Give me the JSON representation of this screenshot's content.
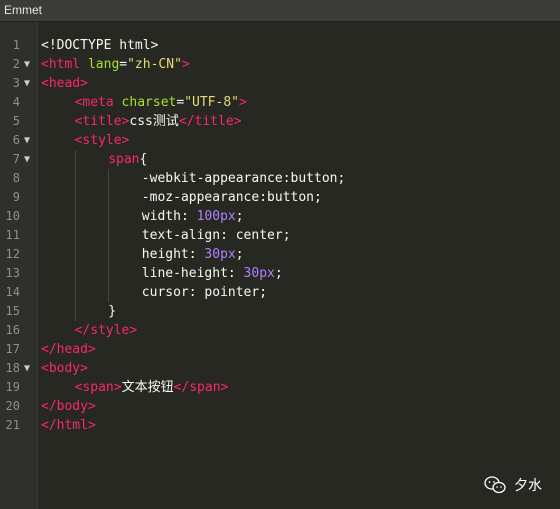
{
  "window": {
    "title": "Emmet"
  },
  "code": {
    "lines": [
      {
        "n": "1",
        "fold": "",
        "indent": 0,
        "tokens": [
          {
            "t": "<!DOCTYPE html>",
            "c": "txt"
          }
        ]
      },
      {
        "n": "2",
        "fold": "▼",
        "indent": 0,
        "tokens": [
          {
            "t": "<",
            "c": "tag"
          },
          {
            "t": "html",
            "c": "tag"
          },
          {
            "t": " lang",
            "c": "attr"
          },
          {
            "t": "=",
            "c": "txt"
          },
          {
            "t": "\"zh-CN\"",
            "c": "str"
          },
          {
            "t": ">",
            "c": "tag"
          }
        ]
      },
      {
        "n": "3",
        "fold": "▼",
        "indent": 0,
        "tokens": [
          {
            "t": "<head>",
            "c": "tag"
          }
        ]
      },
      {
        "n": "4",
        "fold": "",
        "indent": 1,
        "tokens": [
          {
            "t": "<meta",
            "c": "tag"
          },
          {
            "t": " charset",
            "c": "attr"
          },
          {
            "t": "=",
            "c": "txt"
          },
          {
            "t": "\"UTF-8\"",
            "c": "str"
          },
          {
            "t": ">",
            "c": "tag"
          }
        ]
      },
      {
        "n": "5",
        "fold": "",
        "indent": 1,
        "tokens": [
          {
            "t": "<title>",
            "c": "tag"
          },
          {
            "t": "css测试",
            "c": "txt"
          },
          {
            "t": "</title>",
            "c": "tag"
          }
        ]
      },
      {
        "n": "6",
        "fold": "▼",
        "indent": 1,
        "tokens": [
          {
            "t": "<style>",
            "c": "tag"
          }
        ]
      },
      {
        "n": "7",
        "fold": "▼",
        "indent": 2,
        "tokens": [
          {
            "t": "span",
            "c": "sel"
          },
          {
            "t": "{",
            "c": "txt"
          }
        ]
      },
      {
        "n": "8",
        "fold": "",
        "indent": 3,
        "tokens": [
          {
            "t": "-webkit-",
            "c": "txt"
          },
          {
            "t": "appearance",
            "c": "prop"
          },
          {
            "t": ":button;",
            "c": "txt"
          }
        ]
      },
      {
        "n": "9",
        "fold": "",
        "indent": 3,
        "tokens": [
          {
            "t": "-moz-",
            "c": "txt"
          },
          {
            "t": "appearance",
            "c": "prop"
          },
          {
            "t": ":button;",
            "c": "txt"
          }
        ]
      },
      {
        "n": "10",
        "fold": "",
        "indent": 3,
        "tokens": [
          {
            "t": "width",
            "c": "prop"
          },
          {
            "t": ": ",
            "c": "txt"
          },
          {
            "t": "100px",
            "c": "num"
          },
          {
            "t": ";",
            "c": "txt"
          }
        ]
      },
      {
        "n": "11",
        "fold": "",
        "indent": 3,
        "tokens": [
          {
            "t": "text-align",
            "c": "prop"
          },
          {
            "t": ": center;",
            "c": "txt"
          }
        ]
      },
      {
        "n": "12",
        "fold": "",
        "indent": 3,
        "tokens": [
          {
            "t": "height",
            "c": "prop"
          },
          {
            "t": ": ",
            "c": "txt"
          },
          {
            "t": "30px",
            "c": "num"
          },
          {
            "t": ";",
            "c": "txt"
          }
        ]
      },
      {
        "n": "13",
        "fold": "",
        "indent": 3,
        "tokens": [
          {
            "t": "line-height",
            "c": "prop"
          },
          {
            "t": ": ",
            "c": "txt"
          },
          {
            "t": "30px",
            "c": "num"
          },
          {
            "t": ";",
            "c": "txt"
          }
        ]
      },
      {
        "n": "14",
        "fold": "",
        "indent": 3,
        "tokens": [
          {
            "t": "cursor",
            "c": "prop"
          },
          {
            "t": ": pointer;",
            "c": "txt"
          }
        ]
      },
      {
        "n": "15",
        "fold": "",
        "indent": 2,
        "tokens": [
          {
            "t": "}",
            "c": "txt"
          }
        ]
      },
      {
        "n": "16",
        "fold": "",
        "indent": 1,
        "tokens": [
          {
            "t": "</style>",
            "c": "tag"
          }
        ]
      },
      {
        "n": "17",
        "fold": "",
        "indent": 0,
        "tokens": [
          {
            "t": "</head>",
            "c": "tag"
          }
        ]
      },
      {
        "n": "18",
        "fold": "▼",
        "indent": 0,
        "tokens": [
          {
            "t": "<body>",
            "c": "tag"
          }
        ]
      },
      {
        "n": "19",
        "fold": "",
        "indent": 1,
        "tokens": [
          {
            "t": "<span>",
            "c": "tag"
          },
          {
            "t": "文本按钮",
            "c": "txt"
          },
          {
            "t": "</span>",
            "c": "tag"
          }
        ]
      },
      {
        "n": "20",
        "fold": "",
        "indent": 0,
        "tokens": [
          {
            "t": "</body>",
            "c": "tag"
          }
        ]
      },
      {
        "n": "21",
        "fold": "",
        "indent": 0,
        "tokens": [
          {
            "t": "</html>",
            "c": "tag"
          }
        ]
      }
    ]
  },
  "watermark": {
    "icon": "wechat-icon",
    "text": "夕水"
  },
  "colors": {
    "background": "#272822",
    "tag": "#f92672",
    "attribute": "#a6e22e",
    "string": "#e6db74",
    "number": "#ae81ff"
  }
}
